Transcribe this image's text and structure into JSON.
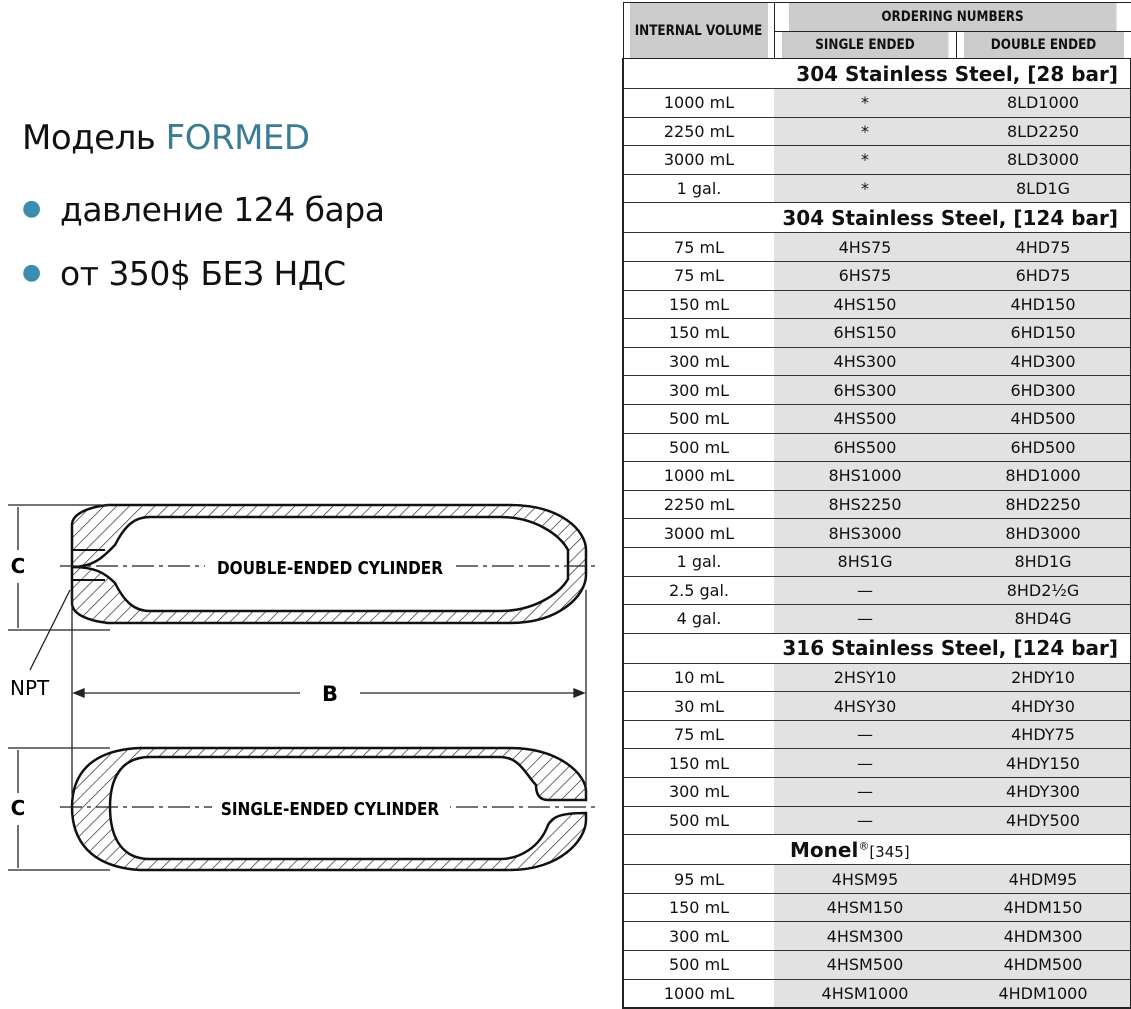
{
  "left": {
    "title_prefix": "Модель",
    "title_accent": "FORMED",
    "bullets": [
      "давление 124 бара",
      "от 350$ БЕЗ НДС"
    ]
  },
  "colors": {
    "accent": "#3a7d93",
    "bullet": "#3a8fb0",
    "table_header": "#cccccc",
    "cell_shade": "#e2e2e2"
  },
  "diagram": {
    "label_c_top": "C",
    "label_c_bottom": "C",
    "label_npt": "NPT",
    "label_b": "B",
    "double_ended": "DOUBLE-ENDED CYLINDER",
    "single_ended": "SINGLE-ENDED CYLINDER"
  },
  "table": {
    "header": {
      "internal_volume": "INTERNAL VOLUME",
      "ordering_numbers": "ORDERING NUMBERS",
      "single_ended": "SINGLE ENDED",
      "double_ended": "DOUBLE ENDED"
    },
    "sections": [
      {
        "title": "304 Stainless Steel, [28 bar]",
        "rows": [
          [
            "1000 mL",
            "*",
            "8LD1000"
          ],
          [
            "2250 mL",
            "*",
            "8LD2250"
          ],
          [
            "3000 mL",
            "*",
            "8LD3000"
          ],
          [
            "1 gal.",
            "*",
            "8LD1G"
          ]
        ]
      },
      {
        "title": "304 Stainless Steel,  [124 bar]",
        "rows": [
          [
            "75 mL",
            "4HS75",
            "4HD75"
          ],
          [
            "75 mL",
            "6HS75",
            "6HD75"
          ],
          [
            "150 mL",
            "4HS150",
            "4HD150"
          ],
          [
            "150 mL",
            "6HS150",
            "6HD150"
          ],
          [
            "300 mL",
            "4HS300",
            "4HD300"
          ],
          [
            "300 mL",
            "6HS300",
            "6HD300"
          ],
          [
            "500 mL",
            "4HS500",
            "4HD500"
          ],
          [
            "500 mL",
            "6HS500",
            "6HD500"
          ],
          [
            "1000 mL",
            "8HS1000",
            "8HD1000"
          ],
          [
            "2250 mL",
            "8HS2250",
            "8HD2250"
          ],
          [
            "3000 mL",
            "8HS3000",
            "8HD3000"
          ],
          [
            "1 gal.",
            "8HS1G",
            "8HD1G"
          ],
          [
            "2.5 gal.",
            "—",
            "8HD2½G"
          ],
          [
            "4 gal.",
            "—",
            "8HD4G"
          ]
        ]
      },
      {
        "title": "316 Stainless Steel, [124 bar]",
        "rows": [
          [
            "10 mL",
            "2HSY10",
            "2HDY10"
          ],
          [
            "30 mL",
            "4HSY30",
            "4HDY30"
          ],
          [
            "75 mL",
            "—",
            "4HDY75"
          ],
          [
            "150 mL",
            "—",
            "4HDY150"
          ],
          [
            "300 mL",
            "—",
            "4HDY300"
          ],
          [
            "500 mL",
            "—",
            "4HDY500"
          ]
        ]
      },
      {
        "title": "Monel",
        "title_sup": "®",
        "title_extra": "[345]",
        "rows": [
          [
            "95 mL",
            "4HSM95",
            "4HDM95"
          ],
          [
            "150 mL",
            "4HSM150",
            "4HDM150"
          ],
          [
            "300 mL",
            "4HSM300",
            "4HDM300"
          ],
          [
            "500 mL",
            "4HSM500",
            "4HDM500"
          ],
          [
            "1000 mL",
            "4HSM1000",
            "4HDM1000"
          ]
        ]
      }
    ]
  }
}
